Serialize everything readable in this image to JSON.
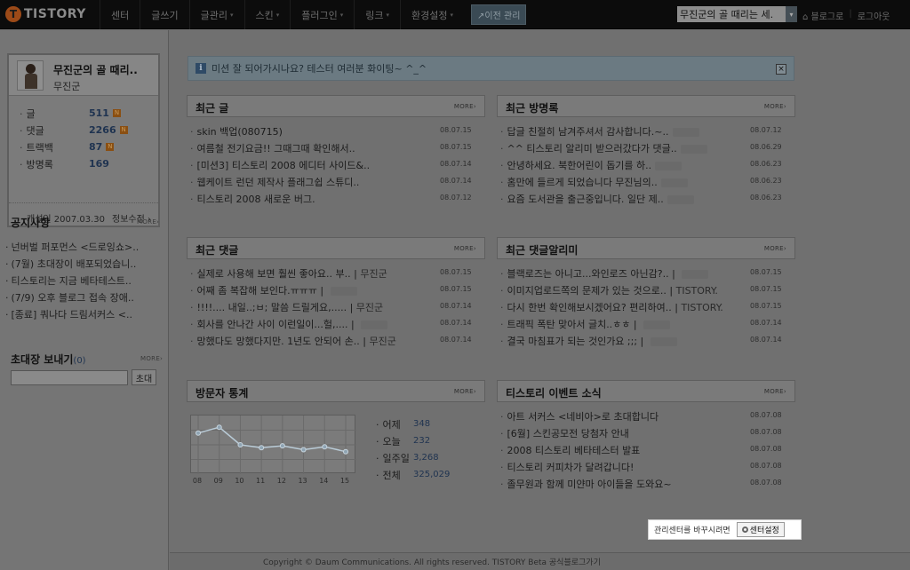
{
  "header": {
    "logo_text": "TISTORY",
    "logo_badge": "T",
    "menu": [
      "센터",
      "글쓰기",
      "글관리",
      "스킨",
      "플러그인",
      "링크",
      "환경설정"
    ],
    "menu_caret": "▾",
    "prev_admin": "↗이전 관리",
    "blog_select": "무진군의 골 때리는 세.",
    "login_links": [
      "⌂ 블로그로",
      "로그아웃"
    ]
  },
  "profile": {
    "title": "무진군의 골 때리..",
    "name": "무진군",
    "stats": [
      {
        "label": "글",
        "value": "511",
        "new": true
      },
      {
        "label": "댓글",
        "value": "2266",
        "new": true
      },
      {
        "label": "트랙백",
        "value": "87",
        "new": true
      },
      {
        "label": "방명록",
        "value": "169",
        "new": false
      }
    ],
    "new_badge": "N",
    "opened": "개설일 2007.03.30",
    "edit": "정보수정 ›"
  },
  "notice": {
    "title": "공지사항",
    "more": "MORE›",
    "items": [
      "넌버벌 퍼포먼스 <드로잉쇼>..",
      "(7월) 초대장이 배포되었습니..",
      "티스토리는 지금 베타테스트..",
      "(7/9) 오후 블로그 접속 장애..",
      "[종료] 쿼나다 드림서커스 <.."
    ]
  },
  "invite": {
    "title": "초대장 보내기",
    "count": "(0)",
    "more": "MORE›",
    "button": "초대"
  },
  "alert": {
    "icon": "i",
    "text": "미션 잘 되어가시나요? 테스터 여러분 화이팅~ ^_^",
    "close": "×"
  },
  "panels": {
    "recent_posts": {
      "title": "최근 글",
      "more": "MORE›",
      "items": [
        {
          "text": "skin 백업(080715)",
          "who": "",
          "date": "08.07.15"
        },
        {
          "text": "여름철 전기요금!! 그때그때 확인해서..",
          "who": "",
          "date": "08.07.15"
        },
        {
          "text": "[미션3] 티스토리 2008 에디터 사이드&..",
          "who": "",
          "date": "08.07.14"
        },
        {
          "text": "웹케이트 런던 제작사 플래그쉽 스튜디..",
          "who": "",
          "date": "08.07.14"
        },
        {
          "text": "티스토리 2008 새로운 버그.",
          "who": "",
          "date": "08.07.12"
        }
      ]
    },
    "guestbook": {
      "title": "최근 방명록",
      "more": "MORE›",
      "items": [
        {
          "text": "답글 친절히 남겨주셔서 감사합니다.~..",
          "who": "",
          "date": "08.07.12"
        },
        {
          "text": "^^ 티스토리 알리미 받으러갔다가 댓글..",
          "who": "",
          "date": "08.06.29"
        },
        {
          "text": "안녕하세요. 북한어린이 돕기를 하..",
          "who": "",
          "date": "08.06.23"
        },
        {
          "text": "홈만에 들르게 되었습니다 무진님의..",
          "who": "",
          "date": "08.06.23"
        },
        {
          "text": "요즘 도서관을 출근중입니다. 일단 제..",
          "who": "",
          "date": "08.06.23"
        }
      ]
    },
    "comments": {
      "title": "최근 댓글",
      "more": "MORE›",
      "items": [
        {
          "text": "실제로 사용해 보면 훨씬 좋아요.. 부..",
          "who": "무진군",
          "date": "08.07.15"
        },
        {
          "text": "어째 좀 복잡해 보인다.ㅠㅠㅠ",
          "who": "",
          "date": "08.07.15"
        },
        {
          "text": "!!!!.... 내일..;ㅂ; 말씀 드릴게요,.....",
          "who": "무진군",
          "date": "08.07.14"
        },
        {
          "text": "회사를 안나간 사이 이런일이...헐,....",
          "who": "",
          "date": "08.07.14"
        },
        {
          "text": "망했다도 망했다지만. 1년도 안되어 손..",
          "who": "무진군",
          "date": "08.07.14"
        }
      ]
    },
    "comment_alarm": {
      "title": "최근 댓글알리미",
      "more": "MORE›",
      "items": [
        {
          "text": "블랙로즈는 아니고...와인로즈 아닌감?..",
          "who": "",
          "date": "08.07.15"
        },
        {
          "text": "이미지업로드쪽의 문제가 있는 것으로..",
          "who": "TISTORY.",
          "date": "08.07.15"
        },
        {
          "text": "다시 한번 확인해보시겠어요? 편리하여..",
          "who": "TISTORY.",
          "date": "08.07.15"
        },
        {
          "text": "트래픽 폭탄 맞아서 글치..ㅎㅎ",
          "who": "",
          "date": "08.07.14"
        },
        {
          "text": "결국 마침표가 되는 것인가요 ;;;",
          "who": "",
          "date": "08.07.14"
        }
      ]
    },
    "visitors": {
      "title": "방문자 통계",
      "more": "MORE›",
      "stats": [
        {
          "label": "어제",
          "value": "348"
        },
        {
          "label": "오늘",
          "value": "232"
        },
        {
          "label": "일주일",
          "value": "3,268"
        },
        {
          "label": "전체",
          "value": "325,029"
        }
      ]
    },
    "events": {
      "title": "티스토리 이벤트 소식",
      "more": "MORE›",
      "items": [
        {
          "text": "아트 서커스 <네비아>로 초대합니다",
          "who": "",
          "date": "08.07.08"
        },
        {
          "text": "[6월] 스킨공모전 당첨자 안내",
          "who": "",
          "date": "08.07.08"
        },
        {
          "text": "2008 티스토리 베타테스터 발표",
          "who": "",
          "date": "08.07.08"
        },
        {
          "text": "티스토리 커피차가 달려갑니다!",
          "who": "",
          "date": "08.07.08"
        },
        {
          "text": "졸무원과 함께 미얀마 아이들을 도와요~",
          "who": "",
          "date": "08.07.08"
        }
      ]
    }
  },
  "chart_data": {
    "type": "line",
    "x": [
      "08",
      "09",
      "10",
      "11",
      "12",
      "13",
      "14",
      "15"
    ],
    "values": [
      360,
      390,
      300,
      285,
      295,
      275,
      290,
      265
    ],
    "ylim": [
      150,
      450
    ],
    "grid": true,
    "color": "#b9cbd7"
  },
  "center_setting": {
    "text": "관리센터를 바꾸시려면",
    "button": "센터설정"
  },
  "footer": {
    "copyright": "Copyright © Daum Communications. All rights reserved. TISTORY Beta 공식블로그가기"
  }
}
